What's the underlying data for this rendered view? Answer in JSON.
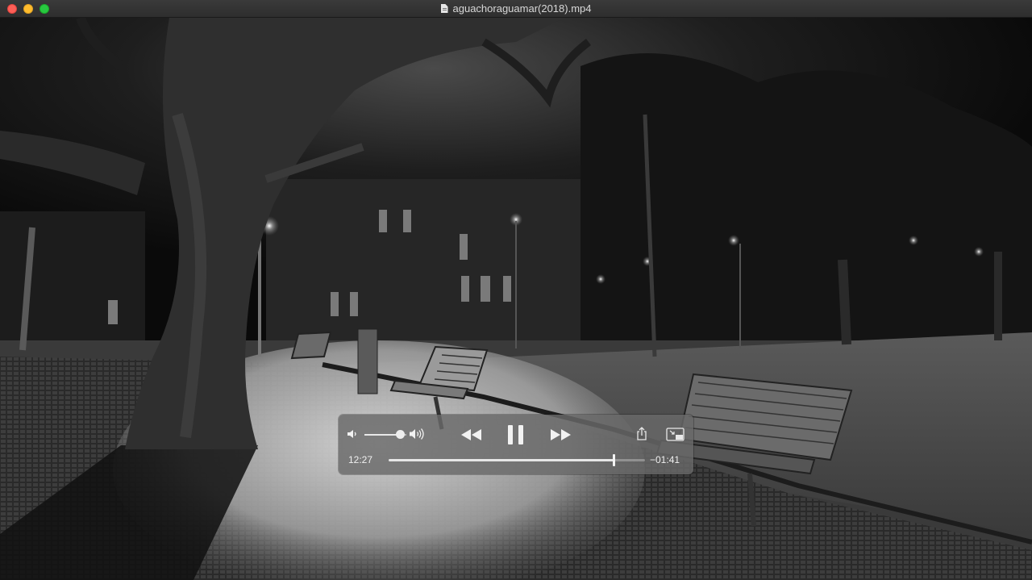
{
  "window": {
    "title": "aguachoraguamar(2018).mp4"
  },
  "player": {
    "current_time": "12:27",
    "remaining_time": "−01:41",
    "progress": 0.878,
    "volume": 0.85,
    "state": "playing"
  },
  "icons": {
    "close": "close-button",
    "minimize": "minimize-button",
    "maximize": "zoom-button",
    "file": "document-icon",
    "volume_low": "speaker-low-icon",
    "volume_high": "speaker-high-icon",
    "rewind": "rewind-icon",
    "pause": "pause-icon",
    "fast_forward": "fast-forward-icon",
    "share": "share-icon",
    "pip": "picture-in-picture-icon"
  },
  "colors": {
    "close": "#fe5f57",
    "minimize": "#febc2e",
    "maximize": "#28c840",
    "hud": "#696969"
  }
}
